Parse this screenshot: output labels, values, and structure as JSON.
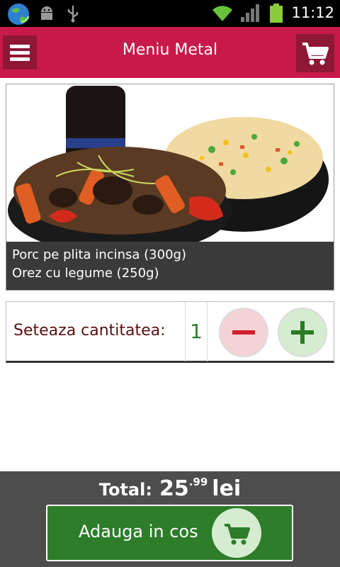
{
  "status_bar": {
    "time": "11:12",
    "icons": [
      "globe-sync-icon",
      "android-debug-icon",
      "usb-icon",
      "wifi-icon",
      "signal-icon",
      "battery-icon"
    ]
  },
  "action_bar": {
    "title": "Meniu Metal",
    "menu_icon": "hamburger-menu-icon",
    "cart_icon": "shopping-cart-icon",
    "color": "#c8194a",
    "button_color": "#8e1736"
  },
  "product": {
    "image": "rice-and-pork-dish-photo",
    "lines": [
      "Porc pe plita incinsa (300g)",
      "Orez cu legume (250g)"
    ]
  },
  "quantity": {
    "label": "Seteaza cantitatea:",
    "value": "1",
    "minus_icon": "minus-icon",
    "plus_icon": "plus-icon"
  },
  "footer": {
    "total_label": "Total:",
    "total_int": "25",
    "total_dec": ".99",
    "currency": "lei",
    "add_button_label": "Adauga in cos",
    "add_icon": "add-to-cart-icon",
    "button_color": "#2d7d2b"
  }
}
